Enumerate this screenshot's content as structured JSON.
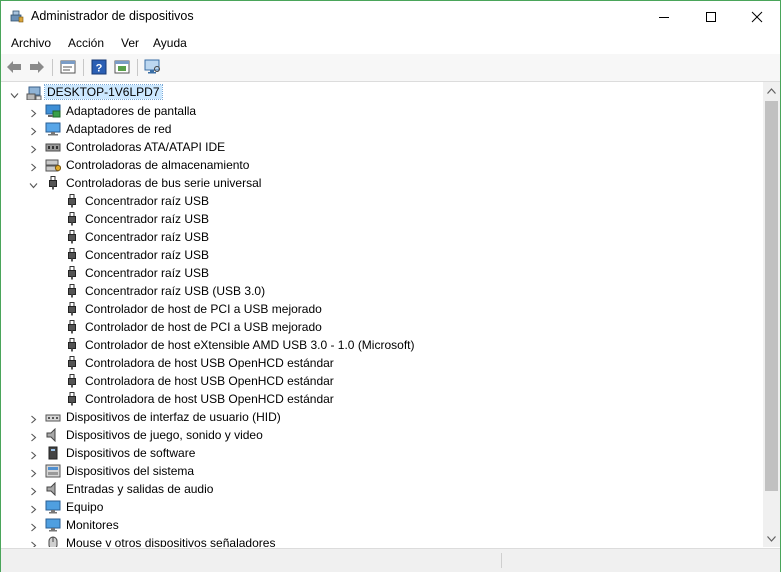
{
  "window": {
    "title": "Administrador de dispositivos",
    "accent_color": "#4aa55a"
  },
  "menu": [
    "Archivo",
    "Acción",
    "Ver",
    "Ayuda"
  ],
  "toolbar": {
    "buttons": [
      "back-arrow-icon",
      "forward-arrow-icon",
      "properties-icon",
      "help-icon",
      "update-driver-icon",
      "scan-hardware-icon"
    ]
  },
  "tree": {
    "root": "DESKTOP-1V6LPD7",
    "categories": [
      {
        "label": "Adaptadores de pantalla",
        "icon": "display-adapter-icon",
        "expanded": false
      },
      {
        "label": "Adaptadores de red",
        "icon": "network-adapter-icon",
        "expanded": false
      },
      {
        "label": "Controladoras ATA/ATAPI IDE",
        "icon": "ide-controller-icon",
        "expanded": false
      },
      {
        "label": "Controladoras de almacenamiento",
        "icon": "storage-controller-icon",
        "expanded": false
      },
      {
        "label": "Controladoras de bus serie universal",
        "icon": "usb-icon",
        "expanded": true,
        "children": [
          "Concentrador raíz USB",
          "Concentrador raíz USB",
          "Concentrador raíz USB",
          "Concentrador raíz USB",
          "Concentrador raíz USB",
          "Concentrador raíz USB (USB 3.0)",
          "Controlador de host de PCI a USB mejorado",
          "Controlador de host de PCI a USB mejorado",
          "Controlador de host eXtensible AMD USB 3.0 - 1.0 (Microsoft)",
          "Controladora de host USB OpenHCD estándar",
          "Controladora de host USB OpenHCD estándar",
          "Controladora de host USB OpenHCD estándar"
        ]
      },
      {
        "label": "Dispositivos de interfaz de usuario (HID)",
        "icon": "hid-icon",
        "expanded": false
      },
      {
        "label": "Dispositivos de juego, sonido y video",
        "icon": "sound-icon",
        "expanded": false
      },
      {
        "label": "Dispositivos de software",
        "icon": "software-device-icon",
        "expanded": false
      },
      {
        "label": "Dispositivos del sistema",
        "icon": "system-device-icon",
        "expanded": false
      },
      {
        "label": "Entradas y salidas de audio",
        "icon": "audio-io-icon",
        "expanded": false
      },
      {
        "label": "Equipo",
        "icon": "computer-icon",
        "expanded": false
      },
      {
        "label": "Monitores",
        "icon": "monitor-icon",
        "expanded": false
      },
      {
        "label": "Mouse y otros dispositivos señaladores",
        "icon": "mouse-icon",
        "expanded": false
      }
    ]
  }
}
